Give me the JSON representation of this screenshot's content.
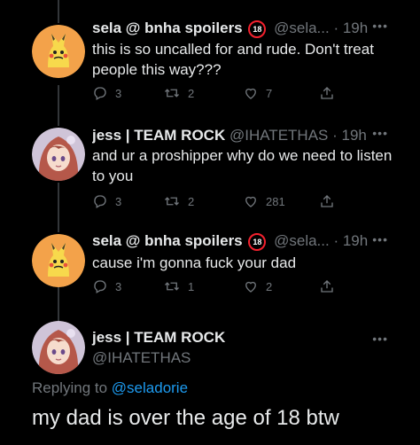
{
  "colors": {
    "background": "#000000",
    "primary_text": "#e7e9ea",
    "secondary_text": "#71767b",
    "link": "#1d9bf0",
    "badge_red": "#f4212e"
  },
  "tweets": [
    {
      "author": {
        "name": "sela @ bnha spoilers",
        "handle": "@sela...",
        "avatar_icon": "mimikyu-avatar"
      },
      "time": "· 19h",
      "badge": "18",
      "text": "this is so uncalled for and rude. Don't treat people this way???",
      "replies": "3",
      "retweets": "2",
      "likes": "7"
    },
    {
      "author": {
        "name": "jess | TEAM ROCK",
        "handle": "@IHATETHAS",
        "avatar_icon": "anime-girl-avatar"
      },
      "time": "· 19h",
      "text": "and ur a proshipper why do we need to listen to you",
      "replies": "3",
      "retweets": "2",
      "likes": "281"
    },
    {
      "author": {
        "name": "sela @ bnha spoilers",
        "handle": "@sela...",
        "avatar_icon": "mimikyu-avatar"
      },
      "time": "· 19h",
      "badge": "18",
      "text": "cause i'm gonna fuck your dad",
      "replies": "3",
      "retweets": "1",
      "likes": "2"
    }
  ],
  "main_tweet": {
    "author": {
      "name": "jess | TEAM ROCK",
      "handle": "@IHATETHAS",
      "avatar_icon": "anime-girl-avatar"
    },
    "replying_prefix": "Replying to",
    "replying_to": "@seladorie",
    "text": "my dad is over the age of 18 btw"
  },
  "icons": {
    "reply": "reply-icon",
    "retweet": "retweet-icon",
    "like": "heart-icon",
    "share": "share-icon",
    "more": "more-icon"
  }
}
